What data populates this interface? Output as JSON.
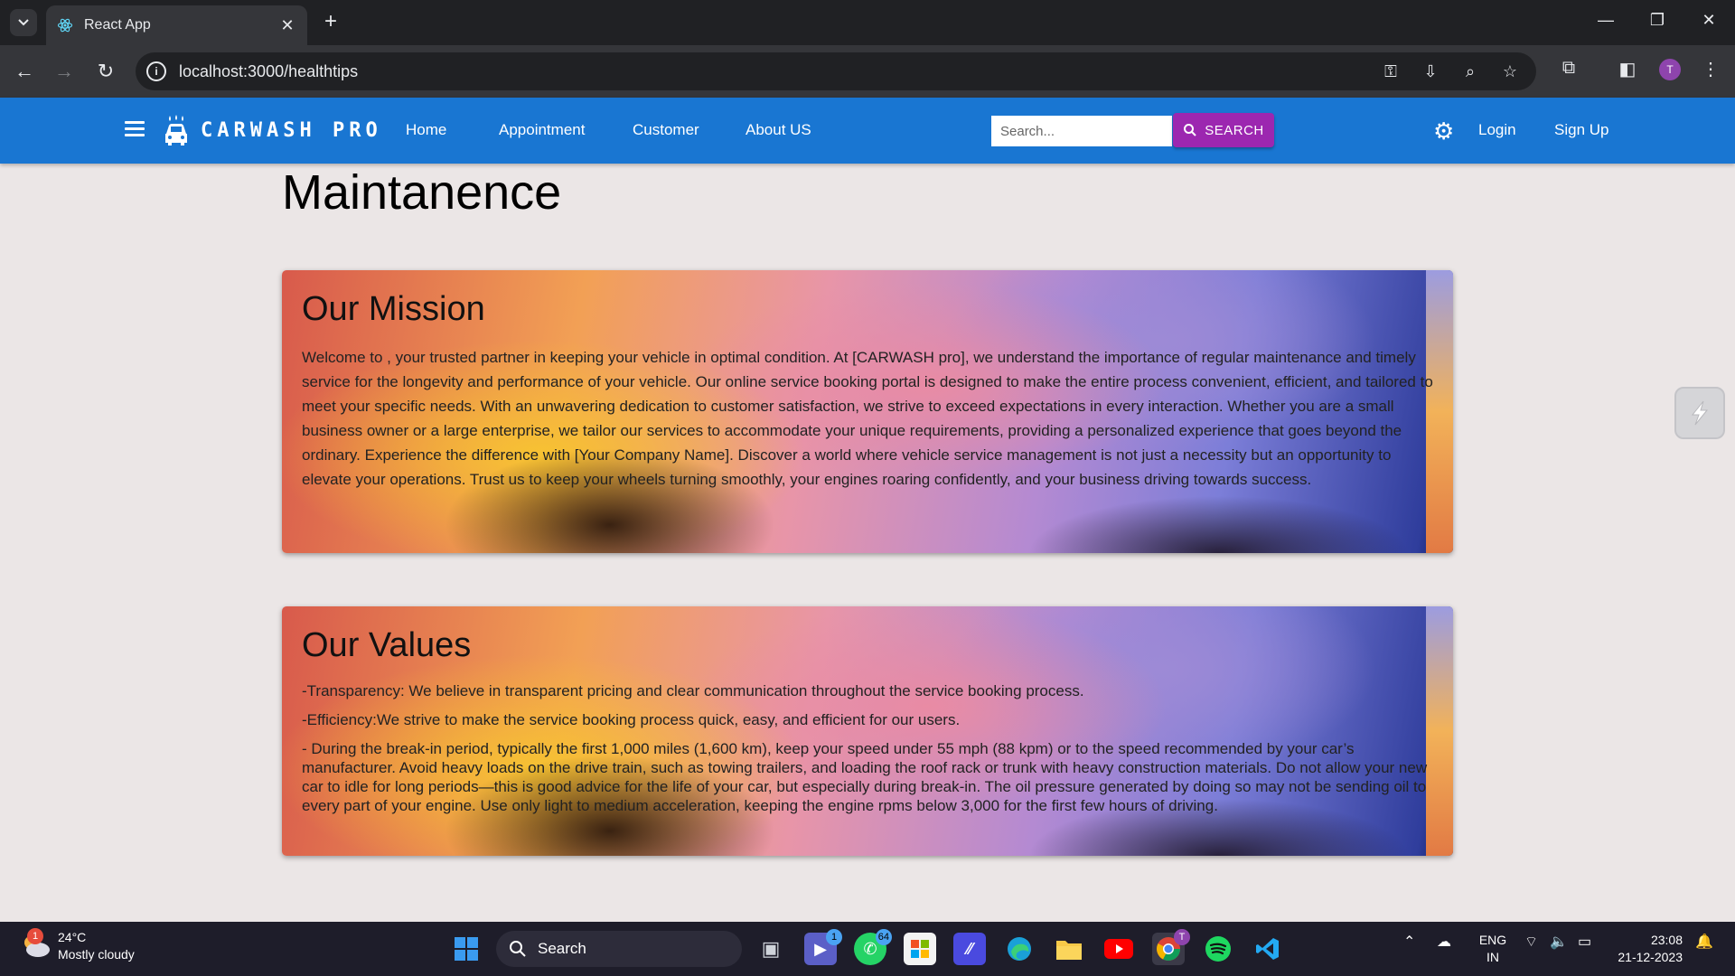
{
  "browser": {
    "tab_title": "React App",
    "url": "localhost:3000/healthtips",
    "profile_initial": "T"
  },
  "header": {
    "brand": "CARWASH PRO",
    "nav": [
      "Home",
      "Appointment",
      "Customer",
      "About US"
    ],
    "search_placeholder": "Search...",
    "search_button": "SEARCH",
    "login": "Login",
    "signup": "Sign Up"
  },
  "page": {
    "title": "Maintanence",
    "mission": {
      "title": "Our Mission",
      "text": "Welcome to , your trusted partner in keeping your vehicle in optimal condition. At [CARWASH pro], we understand the importance of regular maintenance and timely service for the longevity and performance of your vehicle. Our online service booking portal is designed to make the entire process convenient, efficient, and tailored to meet your specific needs. With an unwavering dedication to customer satisfaction, we strive to exceed expectations in every interaction. Whether you are a small business owner or a large enterprise, we tailor our services to accommodate your unique requirements, providing a personalized experience that goes beyond the ordinary. Experience the difference with [Your Company Name]. Discover a world where vehicle service management is not just a necessity but an opportunity to elevate your operations. Trust us to keep your wheels turning smoothly, your engines roaring confidently, and your business driving towards success."
    },
    "values": {
      "title": "Our Values",
      "items": [
        "-Transparency: We believe in transparent pricing and clear communication throughout the service booking process.",
        "-Efficiency:We strive to make the service booking process quick, easy, and efficient for our users.",
        "- During the break-in period, typically the first 1,000 miles (1,600 km), keep your speed under 55 mph (88 kpm) or to the speed recommended by your car’s manufacturer. Avoid heavy loads on the drive train, such as towing trailers, and loading the roof rack or trunk with heavy construction materials. Do not allow your new car to idle for long periods—this is good advice for the life of your car, but especially during break-in. The oil pressure generated by doing so may not be sending oil to every part of your engine. Use only light to medium acceleration, keeping the engine rpms below 3,000 for the first few hours of driving."
      ]
    }
  },
  "taskbar": {
    "weather_temp": "24°C",
    "weather_desc": "Mostly cloudy",
    "weather_badge": "1",
    "search_label": "Search",
    "badges": {
      "teams": "1",
      "whatsapp": "64"
    },
    "chrome_badge": "T",
    "lang": "ENG",
    "region": "IN",
    "time": "23:08",
    "date": "21-12-2023"
  }
}
